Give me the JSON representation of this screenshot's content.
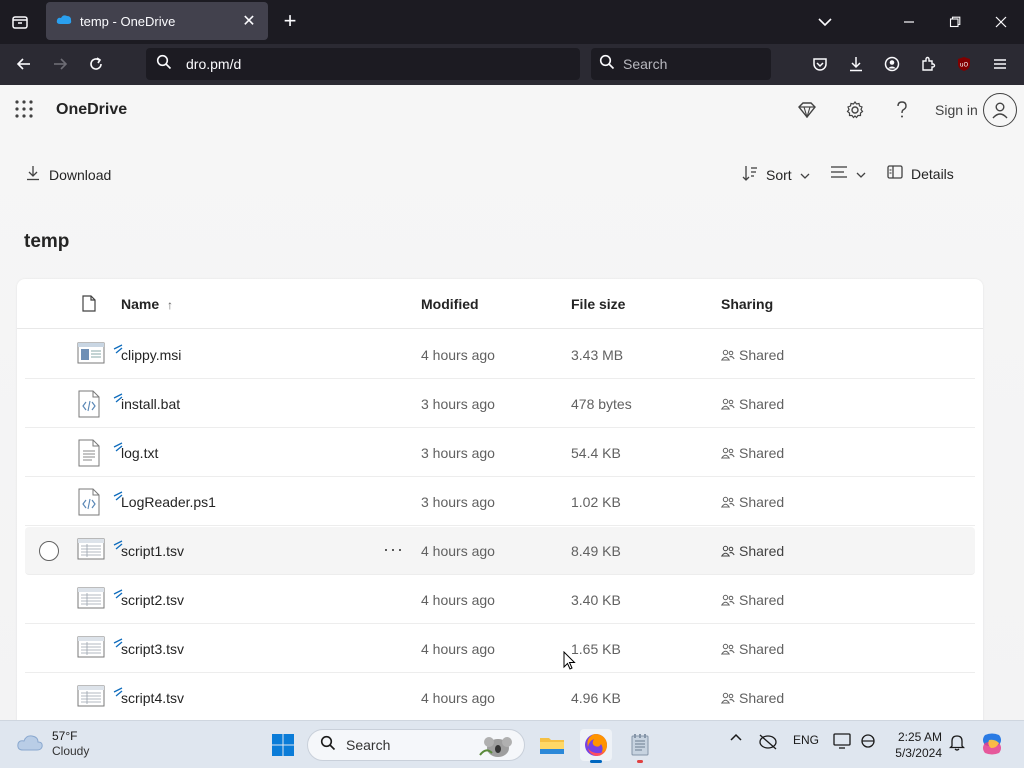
{
  "browser": {
    "tab_title": "temp - OneDrive",
    "url": "dro.pm/d",
    "search_placeholder": "Search"
  },
  "app": {
    "name": "OneDrive",
    "sign_in_label": "Sign in"
  },
  "commands": {
    "download_label": "Download",
    "sort_label": "Sort",
    "details_label": "Details"
  },
  "folder": {
    "title": "temp"
  },
  "columns": {
    "name": "Name",
    "name_sort_indicator": "↑",
    "modified": "Modified",
    "file_size": "File size",
    "sharing": "Sharing"
  },
  "files": [
    {
      "name": "clippy.msi",
      "modified": "4 hours ago",
      "size": "3.43 MB",
      "sharing": "Shared",
      "icon": "installer-file-icon"
    },
    {
      "name": "install.bat",
      "modified": "3 hours ago",
      "size": "478 bytes",
      "sharing": "Shared",
      "icon": "code-file-icon"
    },
    {
      "name": "log.txt",
      "modified": "3 hours ago",
      "size": "54.4 KB",
      "sharing": "Shared",
      "icon": "text-file-icon"
    },
    {
      "name": "LogReader.ps1",
      "modified": "3 hours ago",
      "size": "1.02 KB",
      "sharing": "Shared",
      "icon": "code-file-icon"
    },
    {
      "name": "script1.tsv",
      "modified": "4 hours ago",
      "size": "8.49 KB",
      "sharing": "Shared",
      "icon": "spreadsheet-file-icon"
    },
    {
      "name": "script2.tsv",
      "modified": "4 hours ago",
      "size": "3.40 KB",
      "sharing": "Shared",
      "icon": "spreadsheet-file-icon"
    },
    {
      "name": "script3.tsv",
      "modified": "4 hours ago",
      "size": "1.65 KB",
      "sharing": "Shared",
      "icon": "spreadsheet-file-icon"
    },
    {
      "name": "script4.tsv",
      "modified": "4 hours ago",
      "size": "4.96 KB",
      "sharing": "Shared",
      "icon": "spreadsheet-file-icon"
    }
  ],
  "taskbar": {
    "weather_temp": "57°F",
    "weather_condition": "Cloudy",
    "search_placeholder": "Search",
    "language": "ENG",
    "time": "2:25 AM",
    "date": "5/3/2024"
  },
  "colors": {
    "browser_dark": "#1c1b22",
    "browser_nav": "#2b2a33",
    "accent": "#0067c0",
    "taskbar": "#dfe6ef"
  }
}
